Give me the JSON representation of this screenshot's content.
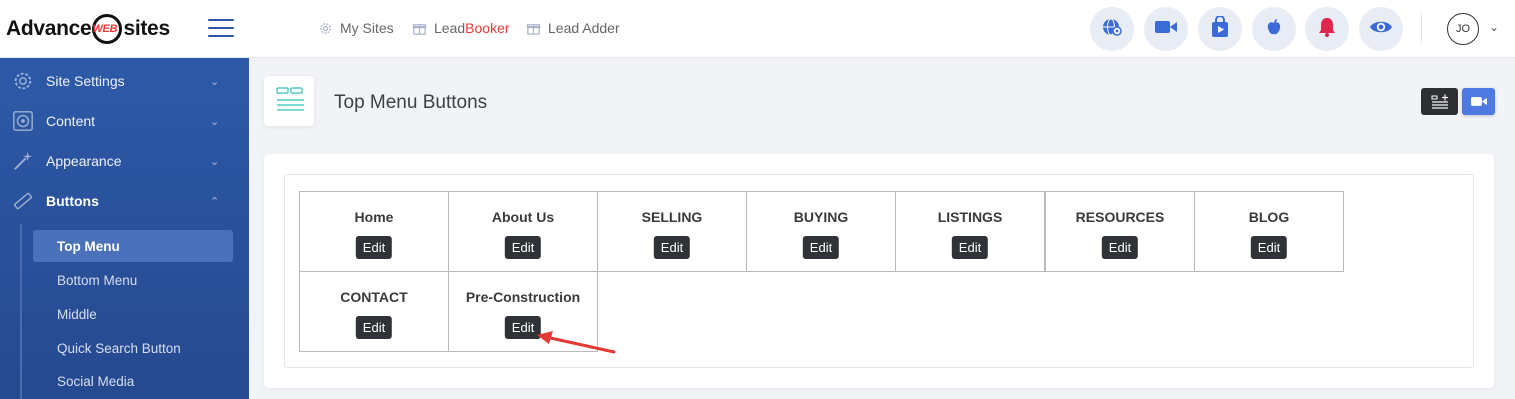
{
  "brand": {
    "logo_left": "Advance",
    "logo_mid": "WEB",
    "logo_right": "sites"
  },
  "topbar": {
    "links": [
      {
        "label": "My Sites",
        "icon": "gear-icon"
      },
      {
        "label_prefix": "Lead",
        "label_accent": "Booker",
        "icon": "gift-icon"
      },
      {
        "label": "Lead Adder",
        "icon": "gift-icon"
      }
    ],
    "action_icons": [
      "globe-settings-icon",
      "video-camera-icon",
      "shopping-bag-icon",
      "apple-icon",
      "bell-icon",
      "eye-icon"
    ],
    "user_initials": "JO",
    "colors": {
      "accent": "#2f55a4",
      "icon_blue": "#3c6ad6",
      "bell_red": "#e0254e",
      "lead_accent": "#e53935"
    }
  },
  "sidebar": {
    "sections": [
      {
        "label": "Site Settings",
        "icon": "gear-icon",
        "expanded": false
      },
      {
        "label": "Content",
        "icon": "disc-icon",
        "expanded": false
      },
      {
        "label": "Appearance",
        "icon": "magic-wand-icon",
        "expanded": false
      },
      {
        "label": "Buttons",
        "icon": "pencil-icon",
        "expanded": true
      }
    ],
    "sub_items": [
      {
        "label": "Top Menu",
        "active": true
      },
      {
        "label": "Bottom Menu",
        "active": false
      },
      {
        "label": "Middle",
        "active": false
      },
      {
        "label": "Quick Search Button",
        "active": false
      },
      {
        "label": "Social Media",
        "active": false
      }
    ]
  },
  "page": {
    "title": "Top Menu Buttons"
  },
  "menu_buttons": {
    "edit_label": "Edit",
    "items": [
      "Home",
      "About Us",
      "SELLING",
      "BUYING",
      "LISTINGS",
      "RESOURCES",
      "BLOG",
      "CONTACT",
      "Pre-Construction"
    ]
  }
}
